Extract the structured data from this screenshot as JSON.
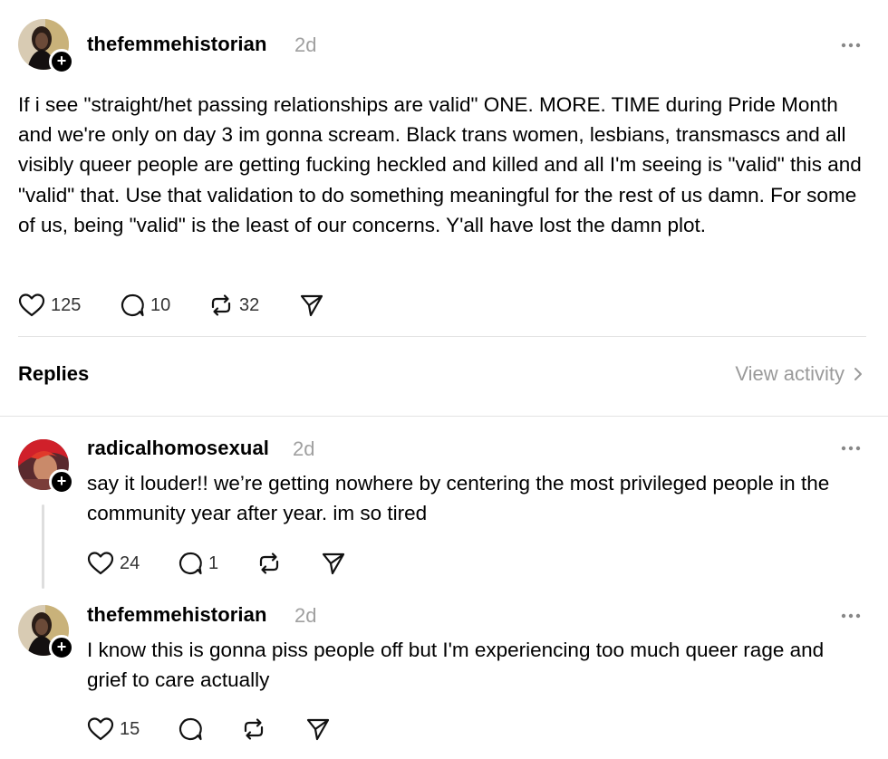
{
  "post": {
    "username": "thefemmehistorian",
    "time": "2d",
    "text": "If i see \"straight/het passing relationships are valid\" ONE. MORE. TIME during Pride Month and we're only on day 3 im gonna scream. Black trans women, lesbians, transmascs and all visibly queer people are getting fucking heckled and killed and all I'm seeing is \"valid\" this and \"valid\" that. Use that validation to do something meaningful for the rest of us damn. For some of us, being \"valid\" is the least of our concerns. Y'all have lost the damn plot.",
    "likes": "125",
    "replies": "10",
    "reposts": "32"
  },
  "replies_header": {
    "title": "Replies",
    "view_activity": "View activity"
  },
  "reply1": {
    "username": "radicalhomosexual",
    "time": "2d",
    "text": "say it louder!! we’re getting nowhere by centering the most privileged people in the community year after year. im so tired",
    "likes": "24",
    "replies": "1",
    "reposts": ""
  },
  "reply2": {
    "username": "thefemmehistorian",
    "time": "2d",
    "text": "I know this is gonna piss people off but I'm experiencing too much queer rage and grief to care actually",
    "likes": "15",
    "replies": "",
    "reposts": ""
  },
  "colors": {
    "text": "#000000",
    "muted": "#a0a0a0",
    "divider": "#e3e3e3"
  },
  "icons": [
    "heart-icon",
    "comment-icon",
    "repost-icon",
    "share-icon",
    "more-icon",
    "plus-icon",
    "chevron-right-icon"
  ]
}
